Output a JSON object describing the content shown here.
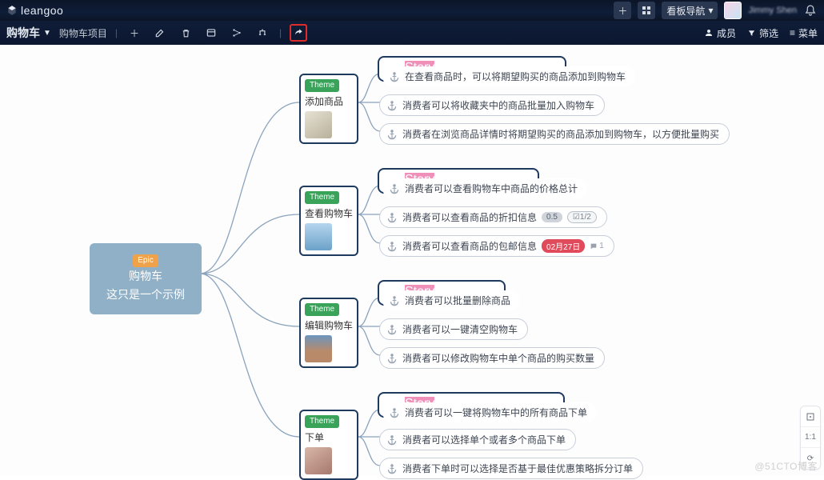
{
  "brand": "leangoo",
  "board_nav_label": "看板导航",
  "user_name": "Jimmy Shen",
  "board": {
    "title": "购物车",
    "project": "购物车项目"
  },
  "subbar_right": {
    "members": "成员",
    "filter": "筛选",
    "menu": "菜单"
  },
  "epic": {
    "tag": "Epic",
    "line1": "购物车",
    "line2": "这只是一个示例"
  },
  "themes": [
    {
      "tag": "Theme",
      "title": "添加商品"
    },
    {
      "tag": "Theme",
      "title": "查看购物车"
    },
    {
      "tag": "Theme",
      "title": "编辑购物车"
    },
    {
      "tag": "Theme",
      "title": "下单"
    }
  ],
  "groups": [
    {
      "tag": "Story",
      "stories": [
        "在查看商品时，可以将期望购买的商品添加到购物车",
        "消费者可以将收藏夹中的商品批量加入购物车",
        "消费者在浏览商品详情时将期望购买的商品添加到购物车，以方便批量购买"
      ]
    },
    {
      "tag": "Story",
      "stories": [
        "消费者可以查看购物车中商品的价格总计",
        "消费者可以查看商品的折扣信息",
        "消费者可以查看商品的包邮信息"
      ],
      "extras": {
        "points": "0.5",
        "checklist": "1/2",
        "date": "02月27日",
        "comments": "1"
      }
    },
    {
      "tag": "Story",
      "stories": [
        "消费者可以批量删除商品",
        "消费者可以一键清空购物车",
        "消费者可以修改购物车中单个商品的购买数量"
      ]
    },
    {
      "tag": "Story",
      "stories": [
        "消费者可以一键将购物车中的所有商品下单",
        "消费者可以选择单个或者多个商品下单",
        "消费者下单时可以选择是否基于最佳优惠策略拆分订单"
      ]
    }
  ],
  "panel": {
    "zoom": "1:1",
    "reset": "⟳"
  },
  "watermark": "@51CTO博客"
}
